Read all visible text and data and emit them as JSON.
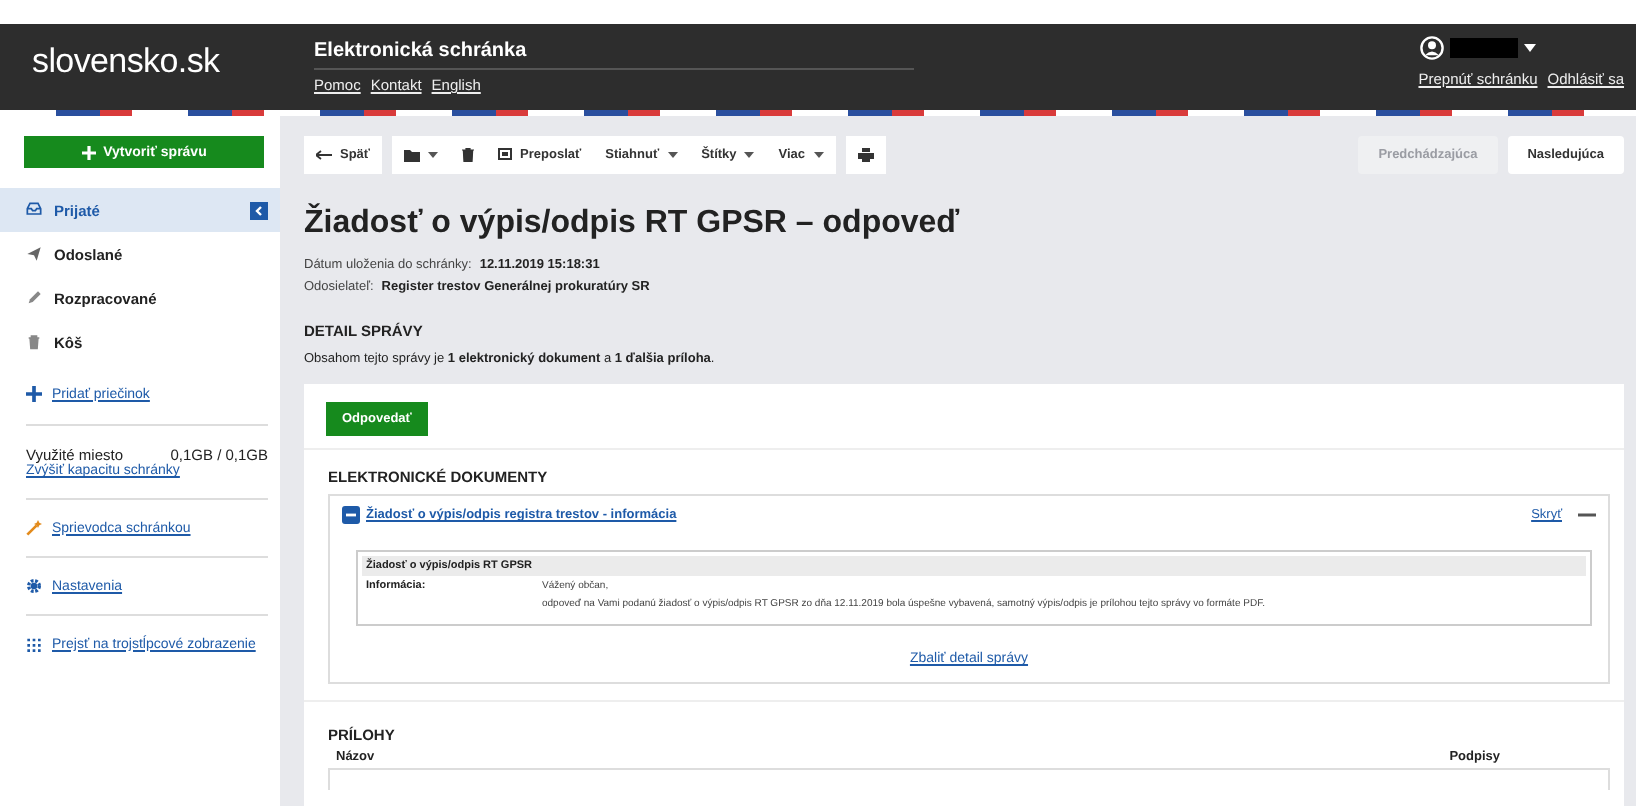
{
  "header": {
    "logo": "slovensko.sk",
    "title": "Elektronická schránka",
    "links": [
      "Pomoc",
      "Kontakt",
      "English"
    ],
    "user_links": [
      "Prepnúť schránku",
      "Odhlásiť sa"
    ]
  },
  "sidebar": {
    "create_button": "Vytvoriť správu",
    "folders": [
      {
        "label": "Prijaté",
        "selected": true
      },
      {
        "label": "Odoslané",
        "selected": false
      },
      {
        "label": "Rozpracované",
        "selected": false
      },
      {
        "label": "Kôš",
        "selected": false
      }
    ],
    "add_folder": "Pridať priečinok",
    "storage_label": "Využité miesto",
    "storage_value": "0,1GB / 0,1GB",
    "storage_link": "Zvýšiť kapacitu schránky",
    "links": [
      {
        "label": "Sprievodca schránkou"
      },
      {
        "label": "Nastavenia"
      },
      {
        "label": "Prejsť na trojstĺpcové zobrazenie"
      }
    ]
  },
  "toolbar": {
    "groups": [
      [
        {
          "kind": "back",
          "label": "Späť"
        }
      ],
      [
        {
          "kind": "folder-menu"
        },
        {
          "kind": "trash"
        },
        {
          "kind": "forward",
          "label": "Preposlať"
        },
        {
          "kind": "menu",
          "label": "Stiahnuť"
        },
        {
          "kind": "menu",
          "label": "Štítky"
        },
        {
          "kind": "menu",
          "label": "Viac"
        }
      ],
      [
        {
          "kind": "print"
        }
      ]
    ],
    "nav": [
      {
        "label": "Predchádzajúca",
        "disabled": true
      },
      {
        "label": "Nasledujúca",
        "disabled": false
      }
    ]
  },
  "message": {
    "title": "Žiadosť o výpis/odpis RT GPSR – odpoveď",
    "meta": [
      {
        "label": "Dátum uloženia do schránky:",
        "value": "12.11.2019 15:18:31"
      },
      {
        "label": "Odosielateľ:",
        "value": "Register trestov Generálnej prokuratúry SR"
      }
    ],
    "detail_heading": "DETAIL SPRÁVY",
    "detail_text": "Obsahom tejto správy je **1 elektronický dokument** a **1 ďalšia príloha**.",
    "reply_button": "Odpovedať",
    "documents_heading": "ELEKTRONICKÉ DOKUMENTY",
    "document": {
      "title": "Žiadosť o výpis/odpis registra trestov - informácia",
      "hide_link": "Skryť",
      "expanded": true,
      "table_title": "Žiadosť o výpis/odpis RT GPSR",
      "field_label": "Informácia:",
      "lines": [
        "Vážený občan,",
        "odpoveď na Vami podanú žiadosť o výpis/odpis RT GPSR zo dňa 12.11.2019 bola úspešne vybavená, samotný výpis/odpis je prílohou tejto správy vo formáte PDF."
      ]
    },
    "collapse_link": "Zbaliť detail správy",
    "attachments_heading": "PRÍLOHY",
    "columns": [
      "Názov",
      "Podpisy"
    ]
  }
}
